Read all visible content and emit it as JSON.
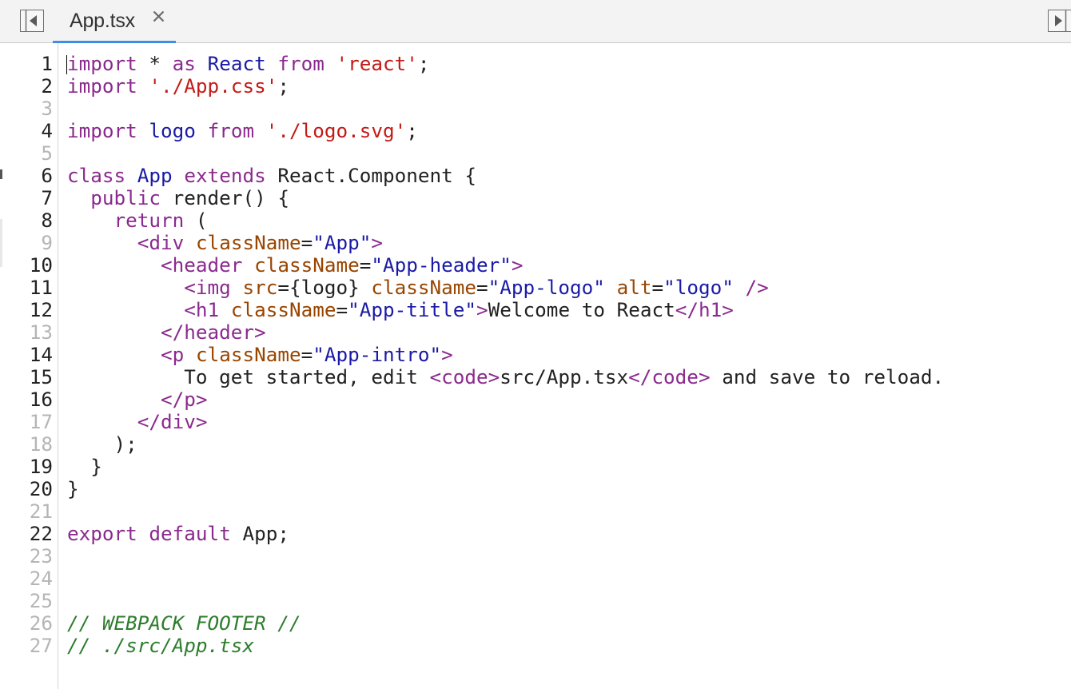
{
  "tab": {
    "title": "App.tsx",
    "close_symbol": "✕"
  },
  "icons": {
    "left_panel_toggle": "collapse-left-panel-icon",
    "right_panel_toggle": "collapse-right-panel-icon",
    "close_tab": "close-icon"
  },
  "colors": {
    "keyword": "#8b2a8e",
    "identifier": "#1a1aa6",
    "string": "#c41a16",
    "attribute": "#994500",
    "tag": "#8b2a8e",
    "attr_string": "#1a1aa6",
    "comment": "#2d7d2d",
    "plain": "#222222",
    "tab_underline": "#3d8ee8"
  },
  "editor": {
    "lines": [
      {
        "num": "1",
        "dim": false,
        "tokens": [
          {
            "t": "import",
            "c": "keyword"
          },
          {
            "t": " * ",
            "c": "plain"
          },
          {
            "t": "as",
            "c": "keyword"
          },
          {
            "t": " ",
            "c": "plain"
          },
          {
            "t": "React",
            "c": "identifier"
          },
          {
            "t": " ",
            "c": "plain"
          },
          {
            "t": "from",
            "c": "keyword"
          },
          {
            "t": " ",
            "c": "plain"
          },
          {
            "t": "'react'",
            "c": "string"
          },
          {
            "t": ";",
            "c": "plain"
          }
        ]
      },
      {
        "num": "2",
        "dim": false,
        "tokens": [
          {
            "t": "import",
            "c": "keyword"
          },
          {
            "t": " ",
            "c": "plain"
          },
          {
            "t": "'./App.css'",
            "c": "string"
          },
          {
            "t": ";",
            "c": "plain"
          }
        ]
      },
      {
        "num": "3",
        "dim": true,
        "tokens": []
      },
      {
        "num": "4",
        "dim": false,
        "tokens": [
          {
            "t": "import",
            "c": "keyword"
          },
          {
            "t": " ",
            "c": "plain"
          },
          {
            "t": "logo",
            "c": "identifier"
          },
          {
            "t": " ",
            "c": "plain"
          },
          {
            "t": "from",
            "c": "keyword"
          },
          {
            "t": " ",
            "c": "plain"
          },
          {
            "t": "'./logo.svg'",
            "c": "string"
          },
          {
            "t": ";",
            "c": "plain"
          }
        ]
      },
      {
        "num": "5",
        "dim": true,
        "tokens": []
      },
      {
        "num": "6",
        "dim": false,
        "tokens": [
          {
            "t": "class",
            "c": "keyword"
          },
          {
            "t": " ",
            "c": "plain"
          },
          {
            "t": "App",
            "c": "identifier"
          },
          {
            "t": " ",
            "c": "plain"
          },
          {
            "t": "extends",
            "c": "keyword"
          },
          {
            "t": " React.Component {",
            "c": "plain"
          }
        ]
      },
      {
        "num": "7",
        "dim": false,
        "tokens": [
          {
            "t": "  ",
            "c": "plain"
          },
          {
            "t": "public",
            "c": "keyword"
          },
          {
            "t": " render() {",
            "c": "plain"
          }
        ]
      },
      {
        "num": "8",
        "dim": false,
        "tokens": [
          {
            "t": "    ",
            "c": "plain"
          },
          {
            "t": "return",
            "c": "keyword"
          },
          {
            "t": " (",
            "c": "plain"
          }
        ]
      },
      {
        "num": "9",
        "dim": true,
        "tokens": [
          {
            "t": "      ",
            "c": "plain"
          },
          {
            "t": "<div",
            "c": "tag"
          },
          {
            "t": " ",
            "c": "plain"
          },
          {
            "t": "className",
            "c": "attribute"
          },
          {
            "t": "=",
            "c": "plain"
          },
          {
            "t": "\"App\"",
            "c": "attr_string"
          },
          {
            "t": ">",
            "c": "tag"
          }
        ]
      },
      {
        "num": "10",
        "dim": false,
        "tokens": [
          {
            "t": "        ",
            "c": "plain"
          },
          {
            "t": "<header",
            "c": "tag"
          },
          {
            "t": " ",
            "c": "plain"
          },
          {
            "t": "className",
            "c": "attribute"
          },
          {
            "t": "=",
            "c": "plain"
          },
          {
            "t": "\"App-header\"",
            "c": "attr_string"
          },
          {
            "t": ">",
            "c": "tag"
          }
        ]
      },
      {
        "num": "11",
        "dim": false,
        "tokens": [
          {
            "t": "          ",
            "c": "plain"
          },
          {
            "t": "<img",
            "c": "tag"
          },
          {
            "t": " ",
            "c": "plain"
          },
          {
            "t": "src",
            "c": "attribute"
          },
          {
            "t": "={logo} ",
            "c": "plain"
          },
          {
            "t": "className",
            "c": "attribute"
          },
          {
            "t": "=",
            "c": "plain"
          },
          {
            "t": "\"App-logo\"",
            "c": "attr_string"
          },
          {
            "t": " ",
            "c": "plain"
          },
          {
            "t": "alt",
            "c": "attribute"
          },
          {
            "t": "=",
            "c": "plain"
          },
          {
            "t": "\"logo\"",
            "c": "attr_string"
          },
          {
            "t": " ",
            "c": "plain"
          },
          {
            "t": "/>",
            "c": "tag"
          }
        ]
      },
      {
        "num": "12",
        "dim": false,
        "tokens": [
          {
            "t": "          ",
            "c": "plain"
          },
          {
            "t": "<h1",
            "c": "tag"
          },
          {
            "t": " ",
            "c": "plain"
          },
          {
            "t": "className",
            "c": "attribute"
          },
          {
            "t": "=",
            "c": "plain"
          },
          {
            "t": "\"App-title\"",
            "c": "attr_string"
          },
          {
            "t": ">",
            "c": "tag"
          },
          {
            "t": "Welcome to React",
            "c": "plain"
          },
          {
            "t": "</h1>",
            "c": "tag"
          }
        ]
      },
      {
        "num": "13",
        "dim": true,
        "tokens": [
          {
            "t": "        ",
            "c": "plain"
          },
          {
            "t": "</header>",
            "c": "tag"
          }
        ]
      },
      {
        "num": "14",
        "dim": false,
        "tokens": [
          {
            "t": "        ",
            "c": "plain"
          },
          {
            "t": "<p",
            "c": "tag"
          },
          {
            "t": " ",
            "c": "plain"
          },
          {
            "t": "className",
            "c": "attribute"
          },
          {
            "t": "=",
            "c": "plain"
          },
          {
            "t": "\"App-intro\"",
            "c": "attr_string"
          },
          {
            "t": ">",
            "c": "tag"
          }
        ]
      },
      {
        "num": "15",
        "dim": false,
        "tokens": [
          {
            "t": "          To get started, edit ",
            "c": "plain"
          },
          {
            "t": "<code>",
            "c": "tag"
          },
          {
            "t": "src/App.tsx",
            "c": "plain"
          },
          {
            "t": "</code>",
            "c": "tag"
          },
          {
            "t": " and save to reload.",
            "c": "plain"
          }
        ]
      },
      {
        "num": "16",
        "dim": false,
        "tokens": [
          {
            "t": "        ",
            "c": "plain"
          },
          {
            "t": "</p>",
            "c": "tag"
          }
        ]
      },
      {
        "num": "17",
        "dim": true,
        "tokens": [
          {
            "t": "      ",
            "c": "plain"
          },
          {
            "t": "</div>",
            "c": "tag"
          }
        ]
      },
      {
        "num": "18",
        "dim": true,
        "tokens": [
          {
            "t": "    );",
            "c": "plain"
          }
        ]
      },
      {
        "num": "19",
        "dim": false,
        "tokens": [
          {
            "t": "  }",
            "c": "plain"
          }
        ]
      },
      {
        "num": "20",
        "dim": false,
        "tokens": [
          {
            "t": "}",
            "c": "plain"
          }
        ]
      },
      {
        "num": "21",
        "dim": true,
        "tokens": []
      },
      {
        "num": "22",
        "dim": false,
        "tokens": [
          {
            "t": "export",
            "c": "keyword"
          },
          {
            "t": " ",
            "c": "plain"
          },
          {
            "t": "default",
            "c": "keyword"
          },
          {
            "t": " App;",
            "c": "plain"
          }
        ]
      },
      {
        "num": "23",
        "dim": true,
        "tokens": []
      },
      {
        "num": "24",
        "dim": true,
        "tokens": []
      },
      {
        "num": "25",
        "dim": true,
        "tokens": []
      },
      {
        "num": "26",
        "dim": true,
        "tokens": [
          {
            "t": "// WEBPACK FOOTER //",
            "c": "comment"
          }
        ]
      },
      {
        "num": "27",
        "dim": true,
        "tokens": [
          {
            "t": "// ./src/App.tsx",
            "c": "comment"
          }
        ]
      }
    ]
  }
}
